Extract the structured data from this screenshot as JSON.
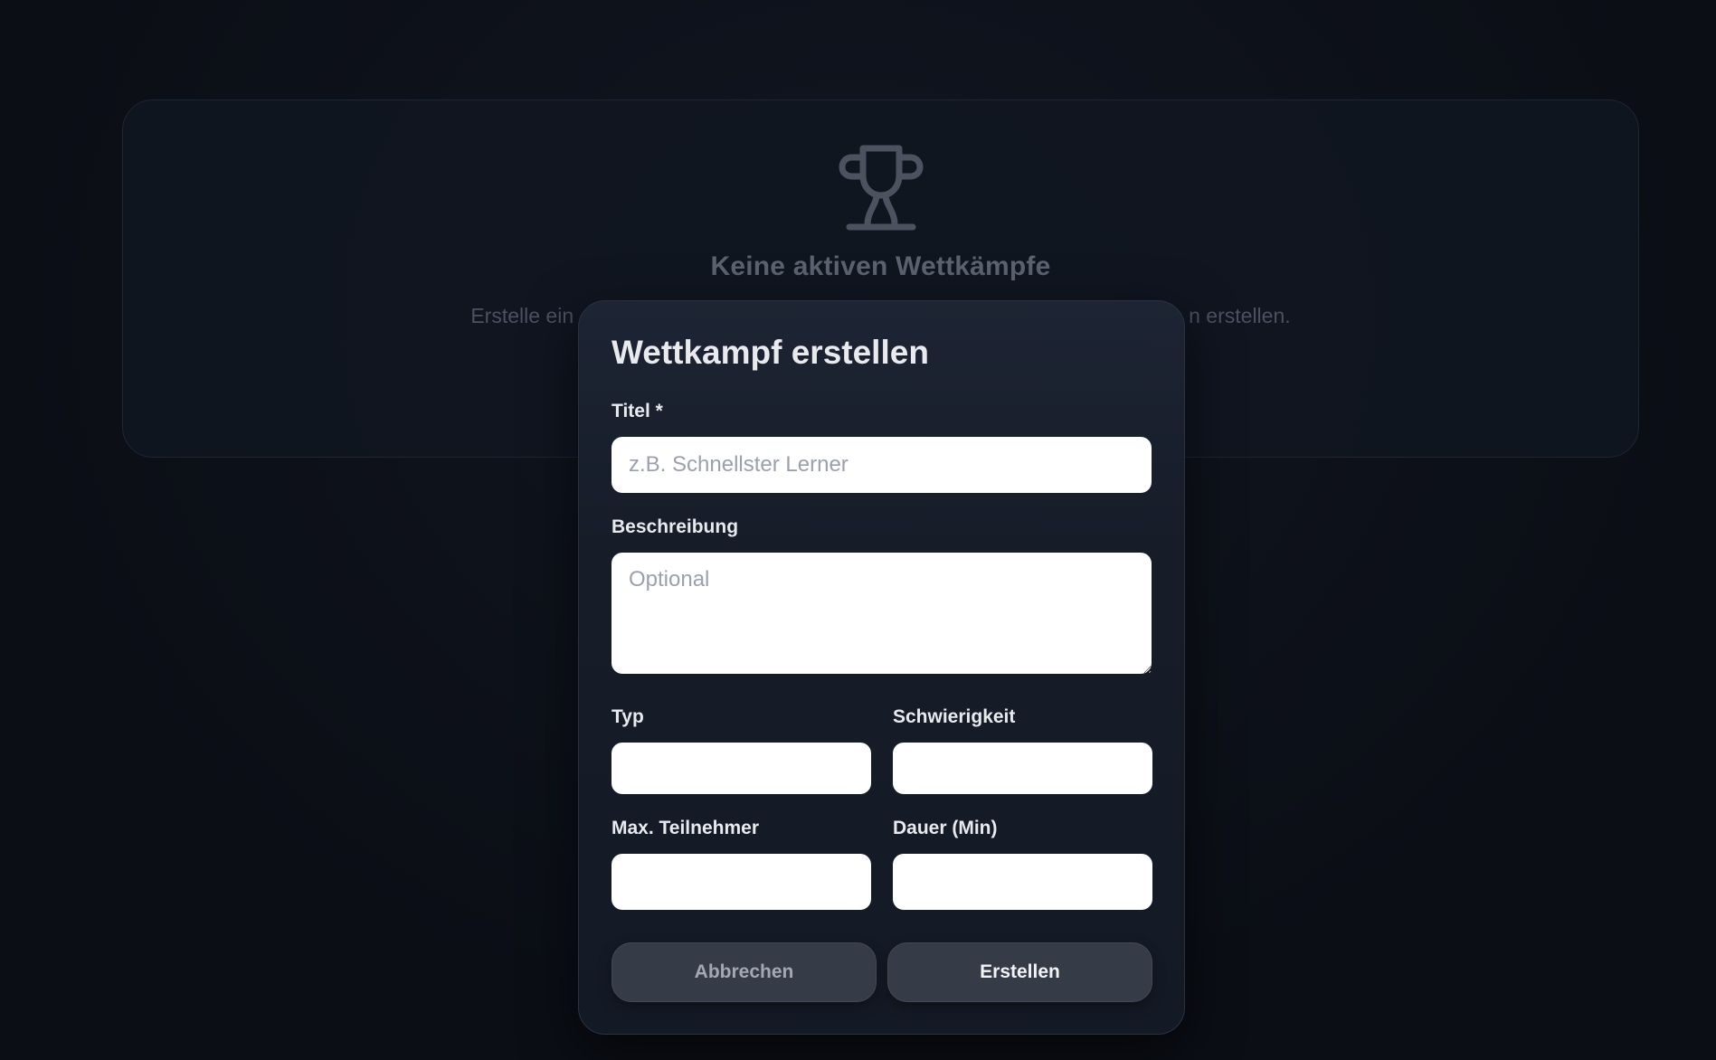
{
  "empty_state": {
    "icon": "trophy-icon",
    "title": "Keine aktiven Wettkämpfe",
    "subtitle_left": "Erstelle ein",
    "subtitle_right": "n erstellen."
  },
  "modal": {
    "title": "Wettkampf erstellen",
    "fields": {
      "title": {
        "label": "Titel *",
        "placeholder": "z.B. Schnellster Lerner",
        "value": ""
      },
      "description": {
        "label": "Beschreibung",
        "placeholder": "Optional",
        "value": ""
      },
      "type": {
        "label": "Typ",
        "value": ""
      },
      "difficulty": {
        "label": "Schwierigkeit",
        "value": ""
      },
      "max_participants": {
        "label": "Max. Teilnehmer",
        "value": ""
      },
      "duration": {
        "label": "Dauer (Min)",
        "value": ""
      }
    },
    "buttons": {
      "cancel": "Abbrechen",
      "create": "Erstellen"
    }
  },
  "colors": {
    "background": "#0b0e15",
    "modal_bg": "#161c28",
    "button_bg": "#353b47",
    "muted_text": "#5b6270"
  }
}
